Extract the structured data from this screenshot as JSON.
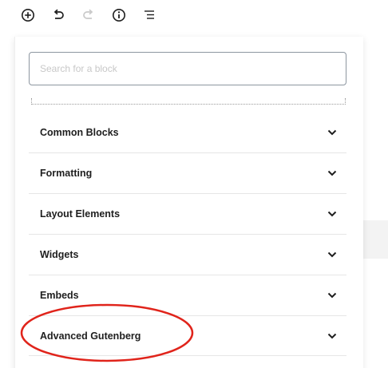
{
  "toolbar": {
    "icons": [
      "add-block-icon",
      "undo-icon",
      "redo-icon",
      "info-icon",
      "block-navigation-icon"
    ]
  },
  "inserter": {
    "search_placeholder": "Search for a block",
    "categories": [
      {
        "label": "Common Blocks",
        "icon": "chevron-down-icon"
      },
      {
        "label": "Formatting",
        "icon": "chevron-down-icon"
      },
      {
        "label": "Layout Elements",
        "icon": "chevron-down-icon"
      },
      {
        "label": "Widgets",
        "icon": "chevron-down-icon"
      },
      {
        "label": "Embeds",
        "icon": "chevron-down-icon"
      },
      {
        "label": "Advanced Gutenberg",
        "icon": "chevron-down-icon",
        "annotated": true
      }
    ]
  },
  "colors": {
    "annotation": "#e0241b",
    "text": "#1e1e1e",
    "redo_disabled": "#c9c9c9"
  }
}
